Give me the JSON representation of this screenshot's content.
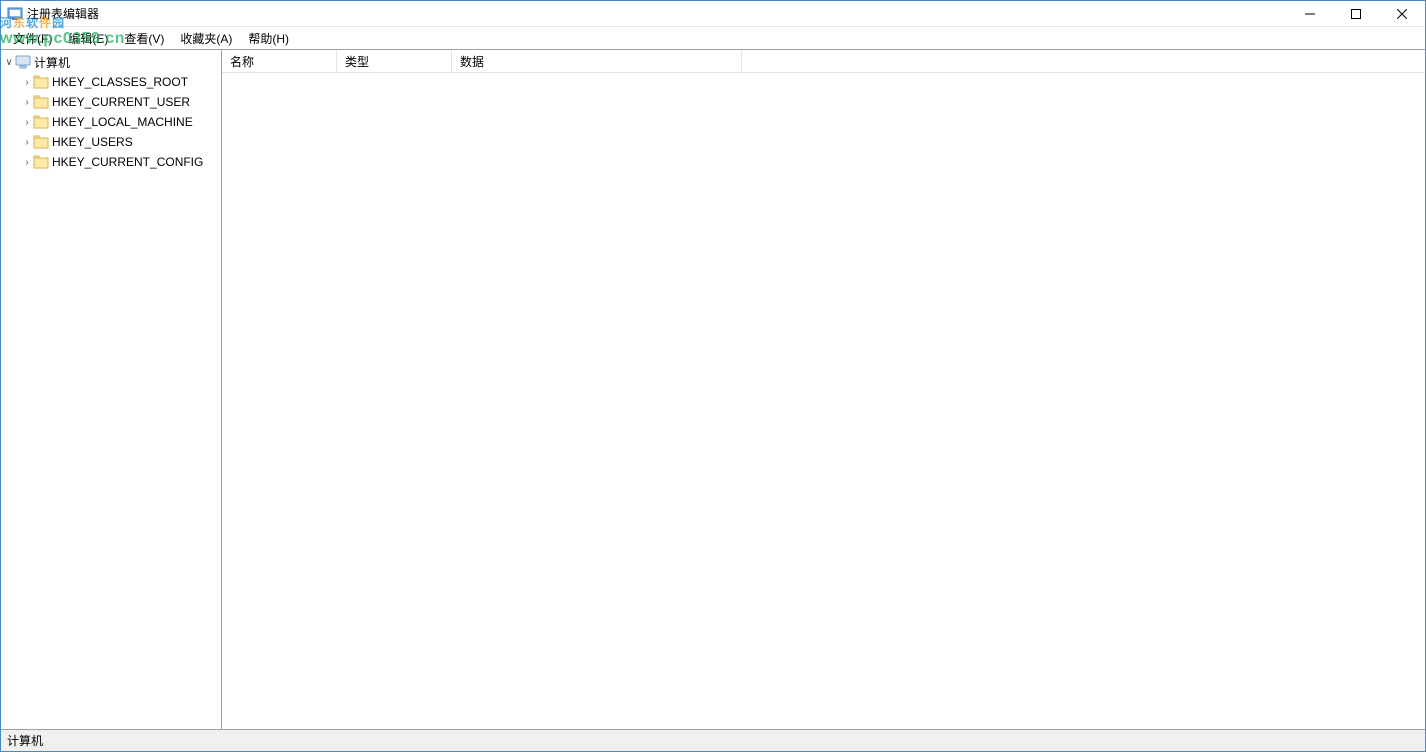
{
  "titlebar": {
    "title": "注册表编辑器"
  },
  "menu": {
    "file": "文件(F)",
    "edit": "编辑(E)",
    "view": "查看(V)",
    "favorites": "收藏夹(A)",
    "help": "帮助(H)"
  },
  "tree": {
    "root": "计算机",
    "keys": [
      "HKEY_CLASSES_ROOT",
      "HKEY_CURRENT_USER",
      "HKEY_LOCAL_MACHINE",
      "HKEY_USERS",
      "HKEY_CURRENT_CONFIG"
    ]
  },
  "list": {
    "headers": {
      "name": "名称",
      "type": "类型",
      "data": "数据"
    }
  },
  "statusbar": {
    "path": "计算机"
  },
  "watermark": {
    "text": "河东软件园",
    "url": "www.pc0359.cn"
  }
}
